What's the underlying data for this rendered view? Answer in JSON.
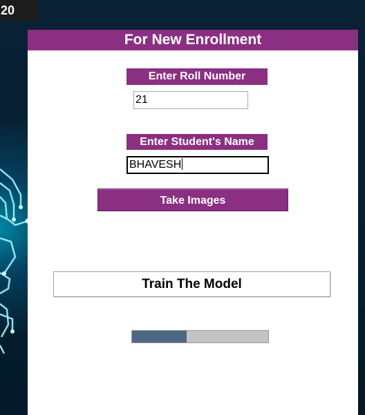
{
  "corner": {
    "label": "20"
  },
  "panel": {
    "title": "For New Enrollment",
    "roll": {
      "label": "Enter Roll Number",
      "value": "21"
    },
    "name": {
      "label": "Enter Student's Name",
      "value": "BHAVESH"
    },
    "take_images_label": "Take Images",
    "train_label": "Train The Model",
    "progress_fraction": 0.4
  },
  "colors": {
    "accent": "#8b2f82",
    "panel_bg": "#ffffff",
    "progress_fill": "#4c6781",
    "progress_track": "#c3c3c3"
  },
  "icons": [
    "circuit-background"
  ]
}
